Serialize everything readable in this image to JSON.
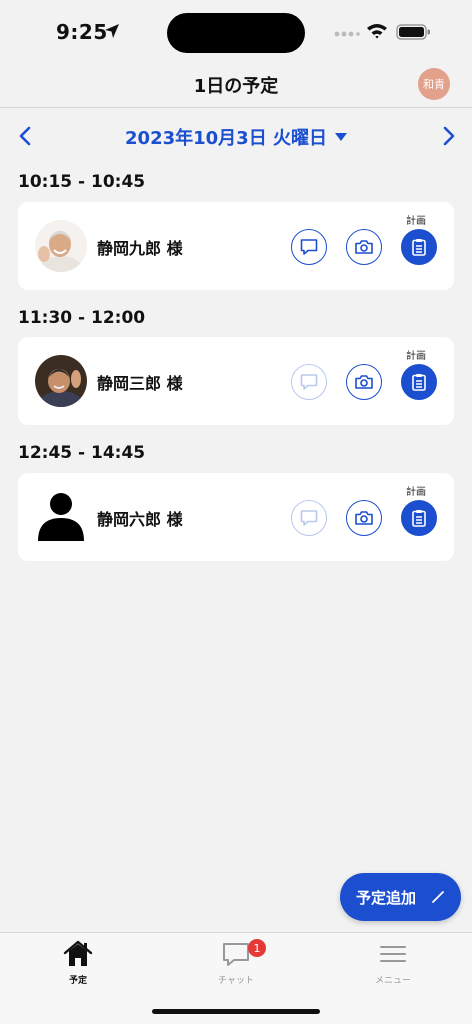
{
  "status_bar": {
    "time": "9:25"
  },
  "header": {
    "title": "1日の予定",
    "user_badge": "和青"
  },
  "date_nav": {
    "date_label": "2023年10月3日 火曜日"
  },
  "appointments": [
    {
      "time": "10:15 - 10:45",
      "name": "静岡九郎 様",
      "plan_label": "計画",
      "chat_enabled": true,
      "avatar_icon": "photo-man-smiling"
    },
    {
      "time": "11:30 - 12:00",
      "name": "静岡三郎 様",
      "plan_label": "計画",
      "chat_enabled": false,
      "avatar_icon": "photo-man-waving"
    },
    {
      "time": "12:45 - 14:45",
      "name": "静岡六郎 様",
      "plan_label": "計画",
      "chat_enabled": false,
      "avatar_icon": "person-silhouette-icon"
    }
  ],
  "fab": {
    "label": "予定追加"
  },
  "tabs": [
    {
      "label": "予定",
      "icon": "home-icon",
      "active": true
    },
    {
      "label": "チャット",
      "icon": "chat-bubble-icon",
      "badge": "1"
    },
    {
      "label": "メニュー",
      "icon": "hamburger-menu-icon"
    }
  ],
  "colors": {
    "accent": "#1c4fd0",
    "background": "#f2f2f2",
    "badge": "#e53935",
    "user_badge": "#e3a08a"
  }
}
